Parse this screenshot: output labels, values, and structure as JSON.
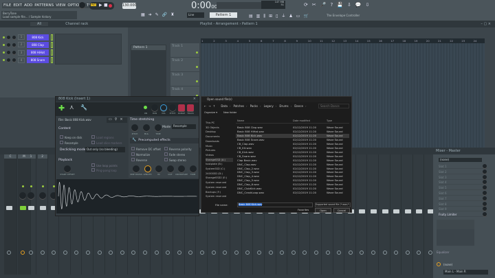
{
  "menu": [
    "FILE",
    "EDIT",
    "ADD",
    "PATTERNS",
    "VIEW",
    "OPTIONS",
    "TOOLS",
    "HELP"
  ],
  "hint": {
    "line1": "BerryTone",
    "line2": "Load sample file... / Sample history"
  },
  "transport": {
    "mode": "PAT",
    "tempo": "130.000",
    "time": "0:00",
    "time_small": "00",
    "mem": "147 MB",
    "cpu": "51",
    "snap": "Line",
    "pattern": "Pattern 1",
    "news": "The Envelope Controller"
  },
  "channel_rack": {
    "title": "Channel rack",
    "filter": "All",
    "channels": [
      {
        "num": "1",
        "name": "808 Kick"
      },
      {
        "num": "2",
        "name": "808 Clap"
      },
      {
        "num": "3",
        "name": "808 HiHat"
      },
      {
        "num": "4",
        "name": "808 Snare"
      }
    ]
  },
  "playlist": {
    "title": "Playlist - Arrangement › Pattern 1",
    "patterns": [
      "Pattern 1"
    ],
    "tracks": [
      "Track 1",
      "Track 2",
      "Track 3",
      "Track 4"
    ],
    "bars": [
      "1",
      "2",
      "3",
      "4",
      "5",
      "6",
      "7",
      "8",
      "9",
      "10",
      "11",
      "12",
      "13",
      "14",
      "15",
      "16",
      "17",
      "18",
      "19",
      "20",
      "21",
      "22",
      "23",
      "24"
    ]
  },
  "sampler": {
    "title": "808 Kick (Insert 1)",
    "top_knobs": [
      "ON",
      "PAN",
      "VOL",
      "PITCH",
      "RANGE",
      "TRACK"
    ],
    "file": "File: Basic 808 Kick.wav",
    "content_title": "Content",
    "content_opts": [
      "Keep on disk",
      "Resample",
      "Load regions",
      "Load slice markers"
    ],
    "declick_label": "Declicking mode",
    "declick_value": "Out only (no bleeding)",
    "playback_title": "Playback",
    "start_offset": "START OFFSET",
    "loop_opts": [
      "Use loop points",
      "Ping-pong loop"
    ],
    "ts_title": "Time stretching",
    "ts_knobs": [
      "PITCH",
      "MUL",
      "TIME"
    ],
    "mode_label": "Mode",
    "mode_value": "Resample",
    "pre_title": "Precomputed effects",
    "pre_opts": [
      "Remove DC offset",
      "Reverse polarity",
      "Normalize",
      "Fade stereo",
      "Reverse",
      "Swap stereo"
    ],
    "fx_knobs": [
      "SMP CROSS",
      "LENGTH",
      "IN",
      "OUT",
      "CROSSFADE",
      "TRIM"
    ]
  },
  "dialog": {
    "title": "Open sound file(s)",
    "breadcrumb": [
      "Data",
      "Patches",
      "Packs",
      "Legacy",
      "Drums",
      "Dance"
    ],
    "search": "Search Dance",
    "organize": "Organize ▾",
    "new_folder": "New folder",
    "cols": [
      "Name",
      "Date modified",
      "Type"
    ],
    "nav": [
      "This PC",
      "3D Objects",
      "Desktop",
      "Documents",
      "Downloads",
      "Music",
      "Pictures",
      "Videos",
      "StorageSSD (A:)",
      "hostplate (B:)",
      "SystemSSD (C:)",
      "240GSSD (D:)",
      "StorageSSD2 (E:)",
      "System reserved",
      "System reserved",
      "Backups (F:)",
      "System reserved"
    ],
    "files": [
      "Basic 808 Clap.wav",
      "Basic 808 HiHat.wav",
      "Basic 808 Kick.wav",
      "Basic 808 Snare.wav",
      "CB_Clap.wav",
      "CB_Kit.wav",
      "CB_Kick.wav",
      "CB_Snare.wav",
      "Clap Basic.wav",
      "DNC_Clap.wav",
      "DNC_Clap_2.wav",
      "DNC_Clap_3.wav",
      "DNC_Clap_4.wav",
      "DNC_Clap_5.wav",
      "DNC_Clap_6.wav",
      "DNC_ClubKick.wav",
      "DNC_CrashLoop.wav"
    ],
    "date": "02/12/2019 11:20",
    "type": "Wave Sound",
    "selected_index": 2,
    "filename_label": "File name:",
    "filename": "Basic 808 Kick.wav",
    "filter": "Supported sound file (*.wav;*.ai",
    "favorites": "Favorites",
    "open": "Open",
    "cancel": "Cancel"
  },
  "mixer": {
    "title": "Mixer - Master",
    "route": "(none)",
    "slots": [
      "Slot 1",
      "Slot 2",
      "Slot 3",
      "Slot 4",
      "Slot 5",
      "Slot 6",
      "Slot 7",
      "Slot 8",
      "Slot 9",
      "Fruity Limiter"
    ],
    "eq": "Equalizer",
    "out_none": "(none)",
    "output": "Main L - Main R",
    "strip_labels": [
      "C",
      "M",
      "1",
      "2"
    ]
  },
  "colors": {
    "channel_button": "#5b4ce0",
    "led": "#9ccb3f",
    "accent_orange": "#e8a020",
    "record": "#d8304a"
  }
}
